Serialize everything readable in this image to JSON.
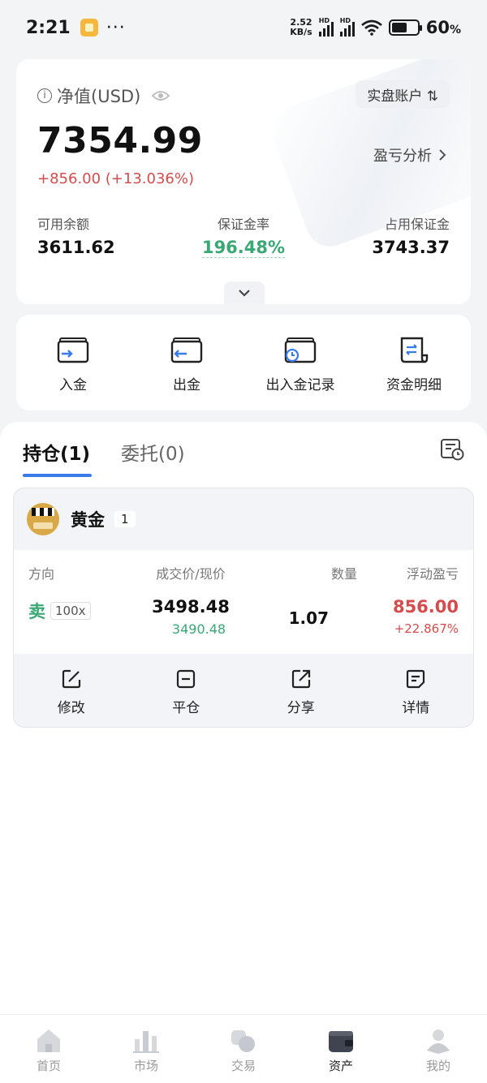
{
  "status_bar": {
    "time": "2:21",
    "dots": "···",
    "net_speed_value": "2.52",
    "net_speed_unit": "KB/s",
    "hd_label": "HD",
    "battery_percent": "60",
    "battery_unit": "%"
  },
  "equity": {
    "label": "净值(USD)",
    "account_switch": "实盘账户 ⇅",
    "value": "7354.99",
    "change": "+856.00 (+13.036%)",
    "pnl_analysis": "盈亏分析",
    "available_label": "可用余额",
    "available_value": "3611.62",
    "margin_rate_label": "保证金率",
    "margin_rate_value": "196.48%",
    "used_margin_label": "占用保证金",
    "used_margin_value": "3743.37"
  },
  "funds": {
    "deposit": "入金",
    "withdraw": "出金",
    "records": "出入金记录",
    "details": "资金明细"
  },
  "tabs": {
    "positions": "持仓(1)",
    "orders": "委托(0)"
  },
  "position": {
    "name": "黄金",
    "count": "1",
    "col_direction": "方向",
    "col_price": "成交价/现价",
    "col_qty": "数量",
    "col_pnl": "浮动盈亏",
    "direction": "卖",
    "leverage": "100x",
    "open_price": "3498.48",
    "current_price": "3490.48",
    "quantity": "1.07",
    "float_pnl": "856.00",
    "float_pct": "+22.867%",
    "actions": {
      "modify": "修改",
      "close": "平仓",
      "share": "分享",
      "detail": "详情"
    }
  },
  "nav": {
    "home": "首页",
    "market": "市场",
    "trade": "交易",
    "assets": "资产",
    "mine": "我的"
  },
  "colors": {
    "accent": "#3a7bea",
    "up_red": "#d64b4b",
    "down_green": "#3aa874"
  }
}
